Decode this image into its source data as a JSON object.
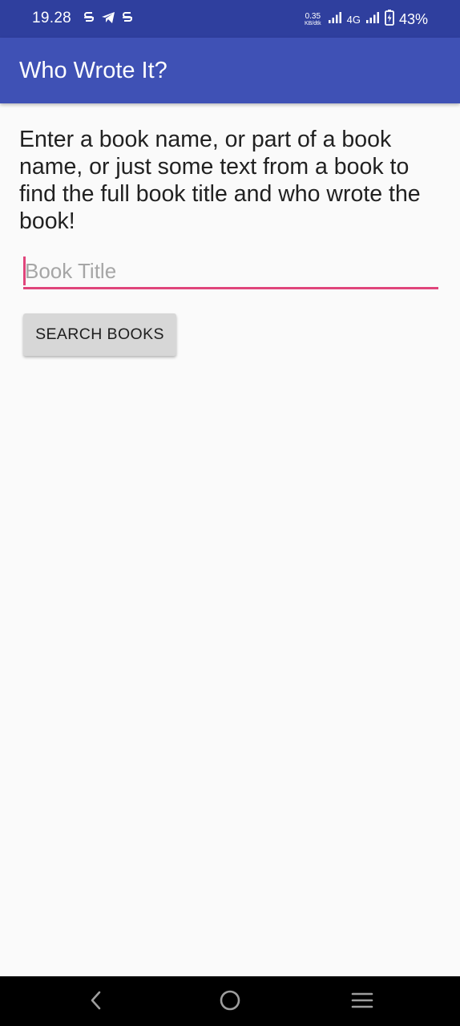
{
  "status_bar": {
    "time": "19.28",
    "net_speed_value": "0.35",
    "net_speed_unit": "KB/dtk",
    "network_type": "4G",
    "battery_percent": "43%",
    "notification_icons": [
      "s-app-icon",
      "telegram-icon",
      "s-app-icon"
    ]
  },
  "app_bar": {
    "title": "Who Wrote It?"
  },
  "main": {
    "instructions": "Enter a book name, or part of a book name, or just some text from a book to find the full book title and who wrote the book!",
    "book_input": {
      "value": "",
      "placeholder": "Book Title"
    },
    "search_button_label": "SEARCH BOOKS"
  },
  "nav_bar": {
    "buttons": [
      "back-icon",
      "home-icon",
      "recents-icon"
    ]
  },
  "colors": {
    "status_bar": "#2f3f9e",
    "app_bar": "#3f51b5",
    "accent": "#e0457b",
    "background": "#fafafa",
    "button": "#d7d7d7"
  }
}
